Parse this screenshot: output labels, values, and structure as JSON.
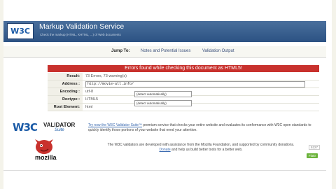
{
  "header": {
    "logo": "W3C",
    "title": "Markup Validation Service",
    "subtitle": "Check the markup (HTML, XHTML, ...) of Web documents"
  },
  "jump": {
    "label": "Jump To:",
    "links": [
      "Notes and Potential Issues",
      "Validation Output"
    ]
  },
  "error_banner": "Errors found while checking this document as HTML5!",
  "results": {
    "result_label": "Result:",
    "result_value": "73 Errors, 73 warning(s)",
    "address_label": "Address :",
    "address_value": "http://movie-all.info/",
    "encoding_label": "Encoding :",
    "encoding_value": "utf-8",
    "encoding_select": "(detect automatically)",
    "doctype_label": "Doctype :",
    "doctype_value": "HTML5",
    "doctype_select": "(detect automatically)",
    "root_label": "Root Element:",
    "root_value": "html"
  },
  "promo": {
    "logo_w3c": "W3C",
    "logo_validator": "VALIDATOR",
    "logo_suite": "Suite",
    "link": "Try now the W3C Validator Suite™",
    "text": " premium service that checks your entire website and evaluates its conformance with W3C open standards to quickly identify those portions of your website that need your attention."
  },
  "sponsor": {
    "logo_text": "mozilla",
    "text1": "The W3C validators are developed with assistance from the Mozilla Foundation, and supported by community donations.",
    "donate_link": "Donate",
    "text2": " and help us build better tools for a better web.",
    "flattr_count": "5227",
    "flattr_label": "Flattr"
  },
  "colors": {
    "header": "#2c5283",
    "error": "#c8312d",
    "link": "#3a6ab0"
  }
}
